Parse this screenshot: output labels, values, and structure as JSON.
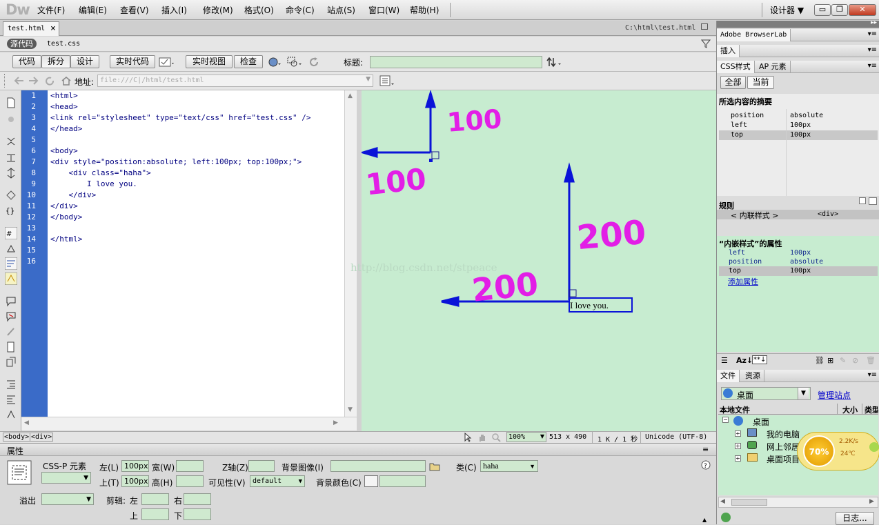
{
  "menubar": {
    "logo": "Dw",
    "items": [
      "文件(F)",
      "编辑(E)",
      "查看(V)",
      "插入(I)",
      "修改(M)",
      "格式(O)",
      "命令(C)",
      "站点(S)",
      "窗口(W)",
      "帮助(H)"
    ],
    "workspace": "设计器 ▼",
    "window_buttons": [
      "▭",
      "❐",
      "✕"
    ]
  },
  "tabs": {
    "doc": "test.html",
    "close": "×",
    "path": "C:\\html\\test.html"
  },
  "related": {
    "source": "源代码",
    "css": "test.css"
  },
  "toolbar": {
    "code": "代码",
    "split": "拆分",
    "design": "设计",
    "live_code": "实时代码",
    "live_view": "实时视图",
    "inspect": "检查",
    "title_label": "标题:",
    "title_value": ""
  },
  "address": {
    "label": "地址:",
    "value": "file:///C|/html/test.html"
  },
  "code": {
    "line_numbers": [
      "1",
      "2",
      "3",
      "4",
      "5",
      "6",
      "7",
      "8",
      "9",
      "10",
      "11",
      "12",
      "13",
      "14",
      "15",
      "16"
    ],
    "lines": [
      "<html>",
      "<head>",
      "<link rel=\"stylesheet\" type=\"text/css\" href=\"test.css\" />",
      "</head>",
      "",
      "<body>",
      "<div style=\"position:absolute; left:100px; top:100px;\">",
      "    <div class=\"haha\">",
      "        I love you.",
      "    </div>",
      "</div>",
      "</body>",
      "",
      "</html>",
      "",
      ""
    ]
  },
  "design": {
    "text": "I love you.",
    "annotations": {
      "top_value": "100",
      "left_value": "100",
      "inner_top": "200",
      "inner_left": "200"
    },
    "watermark": "http://blog.csdn.net/stpeace"
  },
  "status": {
    "tags": [
      "<body>",
      "<div>"
    ],
    "zoom": "100%",
    "size": "513 x 490",
    "weight": "1 K / 1 秒",
    "encoding": "Unicode (UTF-8)"
  },
  "properties": {
    "title": "属性",
    "element_label": "CSS-P 元素",
    "left_label": "左(L)",
    "left_value": "100px",
    "top_label": "上(T)",
    "top_value": "100px",
    "width_label": "宽(W)",
    "height_label": "高(H)",
    "z_label": "Z轴(Z)",
    "vis_label": "可见性(V)",
    "vis_value": "default",
    "bgimg_label": "背景图像(I)",
    "bgcolor_label": "背景颜色(C)",
    "class_label": "类(C)",
    "class_value": "haha",
    "overflow_label": "溢出",
    "clip_label": "剪辑:",
    "clip_left": "左",
    "clip_right": "右",
    "clip_top": "上",
    "clip_bottom": "下"
  },
  "panels": {
    "browserlab": "Adobe BrowserLab",
    "insert": "插入",
    "css_tab": "CSS样式",
    "ap_tab": "AP 元素",
    "all": "全部",
    "current": "当前",
    "summary_title": "所选内容的摘要",
    "summary": [
      {
        "prop": "position",
        "val": "absolute"
      },
      {
        "prop": "left",
        "val": "100px"
      },
      {
        "prop": "top",
        "val": "100px"
      }
    ],
    "rules_title": "规则",
    "rules_left": "< 内联样式 >",
    "rules_right": "<div>",
    "inline_title": "“内嵌样式”的属性",
    "inline_props": [
      {
        "prop": "left",
        "val": "100px"
      },
      {
        "prop": "position",
        "val": "absolute"
      },
      {
        "prop": "top",
        "val": "100px"
      }
    ],
    "add_property": "添加属性",
    "files_tab": "文件",
    "assets_tab": "资源",
    "location": "桌面",
    "manage_sites": "管理站点",
    "col_local": "本地文件",
    "col_size": "大小",
    "col_type": "类型",
    "tree_root": "桌面",
    "tree_items": [
      "我的电脑",
      "网上邻居",
      "桌面项目"
    ],
    "log": "日志...",
    "widget": {
      "percent": "70%",
      "speed": "2.2K/s",
      "temp": "24℃"
    }
  }
}
